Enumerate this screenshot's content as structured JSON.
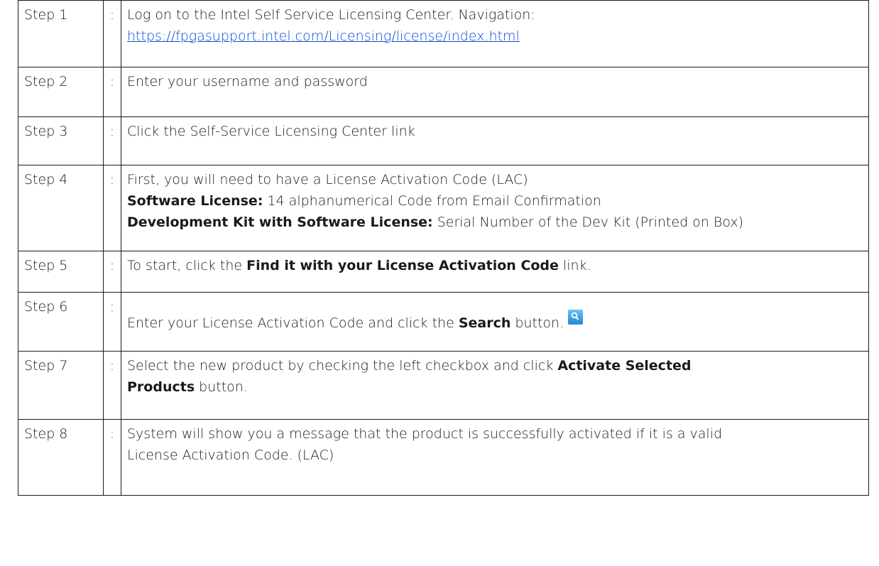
{
  "steps": [
    {
      "label": "Step 1",
      "colon": ":",
      "line1": "Log on to the Intel Self Service Licensing Center. Navigation:",
      "link": "https://fpgasupport.intel.com/Licensing/license/index.html"
    },
    {
      "label": "Step 2",
      "colon": ":",
      "text": "Enter your username and password"
    },
    {
      "label": "Step 3",
      "colon": ":",
      "text": "Click the Self-Service Licensing Center link"
    },
    {
      "label": "Step 4",
      "colon": ":",
      "line1": "First, you will need to have a License Activation Code (LAC)",
      "sw_label": "Software License:",
      "sw_text": " 14 alphanumerical Code from Email Confirmation",
      "dk_label": "Development Kit with Software License:",
      "dk_text": " Serial Number of the Dev Kit (Printed on Box)"
    },
    {
      "label": "Step 5",
      "colon": ":",
      "pre": "To start, click the ",
      "bold": "Find it with your License Activation Code",
      "post": " link."
    },
    {
      "label": "Step 6",
      "colon": ":",
      "pre": "Enter your License Activation Code and click the ",
      "bold": "Search",
      "post": " button.",
      "icon": "search-icon"
    },
    {
      "label": "Step 7",
      "colon": ":",
      "pre": "Select the new product by checking the left checkbox and click ",
      "bold1": "Activate Selected",
      "bold2": "Products",
      "post": " button."
    },
    {
      "label": "Step 8",
      "colon": ":",
      "line1": "System will show you a message that the product is successfully activated if it is a valid",
      "line2": "License Activation Code. (LAC)"
    }
  ]
}
